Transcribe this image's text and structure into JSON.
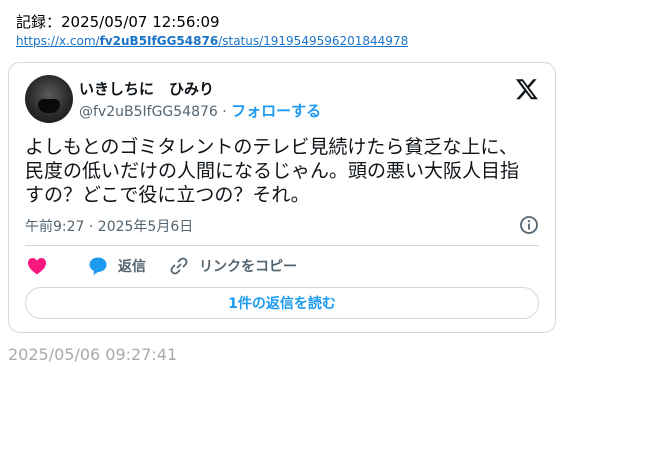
{
  "record": {
    "text": "記録：2025/05/07 12:56:09"
  },
  "source": {
    "prefix": "https://x.com/",
    "handle": "fv2uB5IfGG54876",
    "suffix": "/status/1919549596201844978"
  },
  "tweet": {
    "display_name": "いきしちに　ひみり",
    "handle": "@fv2uB5IfGG54876",
    "separator": " · ",
    "follow_label": "フォローする",
    "text": "よしもとのゴミタレントのテレビ見続けたら貧乏な上に、民度の低いだけの人間になるじゃん。頭の悪い大阪人目指すの？どこで役に立つの？それ。",
    "timestamp": "午前9:27 · 2025年5月6日",
    "actions": {
      "like_icon": "heart-icon",
      "reply_icon": "speech-bubble-icon",
      "reply_label": "返信",
      "copy_icon": "link-icon",
      "copy_label": "リンクをコピー"
    },
    "read_replies_label": "1件の返信を読む",
    "colors": {
      "like": "#f91880",
      "accent": "#1d9bf0",
      "muted": "#536471",
      "border": "#cfd9de"
    }
  },
  "footer": {
    "timestamp": "2025/05/06 09:27:41"
  }
}
